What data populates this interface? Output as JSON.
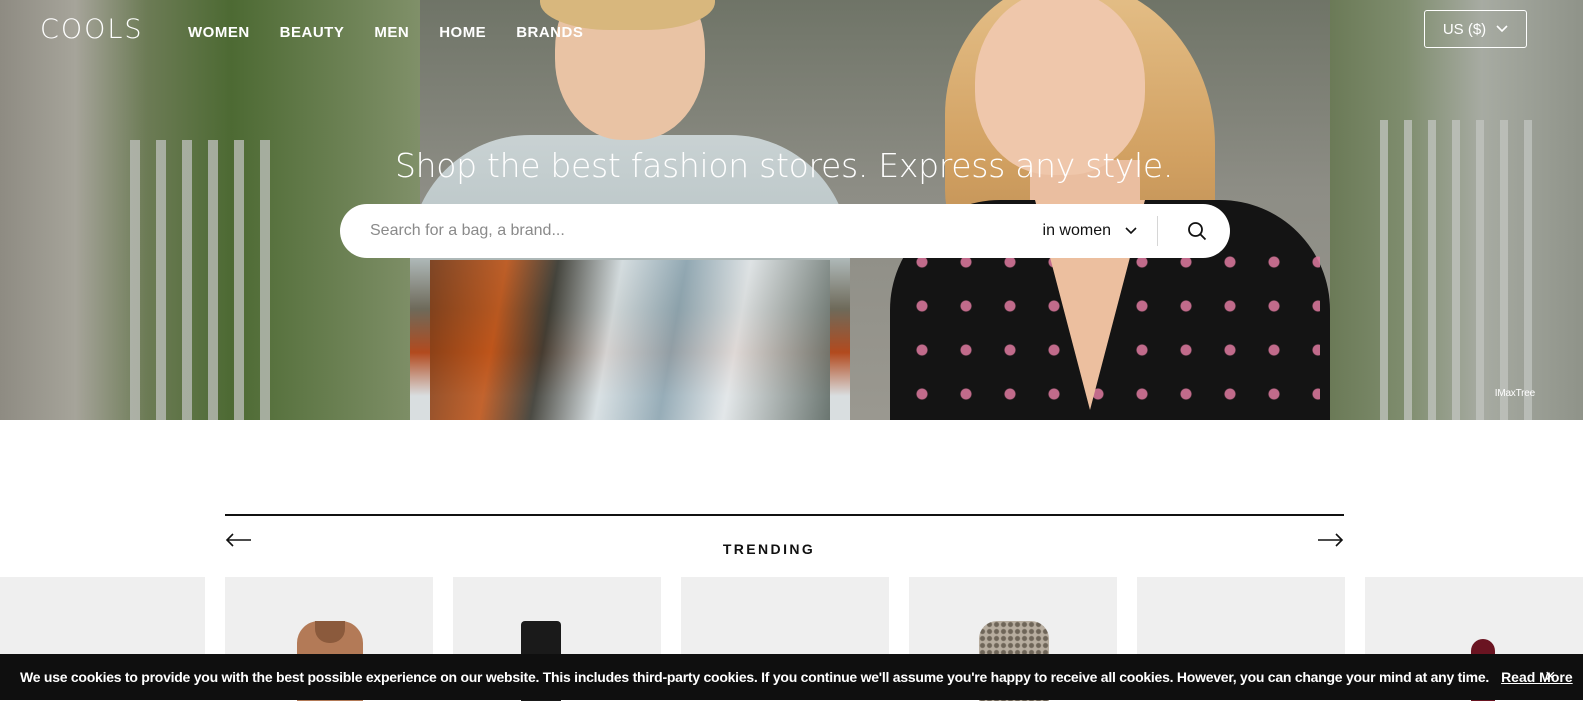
{
  "header": {
    "logo": "COOLS",
    "nav": [
      "WOMEN",
      "BEAUTY",
      "MEN",
      "HOME",
      "BRANDS"
    ],
    "currency": "US ($)"
  },
  "hero": {
    "headline": "Shop the best fashion stores. Express any style.",
    "search_placeholder": "Search for a bag, a brand...",
    "search_scope": "in women",
    "photo_credit": "IMaxTree"
  },
  "trending": {
    "title": "TRENDING",
    "products": [
      "coat",
      "boot",
      "",
      "dress",
      "",
      "shoe"
    ]
  },
  "cookie": {
    "text": "We use cookies to provide you with the best possible experience on our website. This includes third-party cookies. If you continue we'll assume you're happy to receive all cookies. However, you can change your mind at any time.",
    "link": "Read More",
    "close": "×"
  },
  "colors": {
    "accent": "#111111",
    "card_bg": "#efefef",
    "cookie_bg": "#0f0f0f"
  }
}
